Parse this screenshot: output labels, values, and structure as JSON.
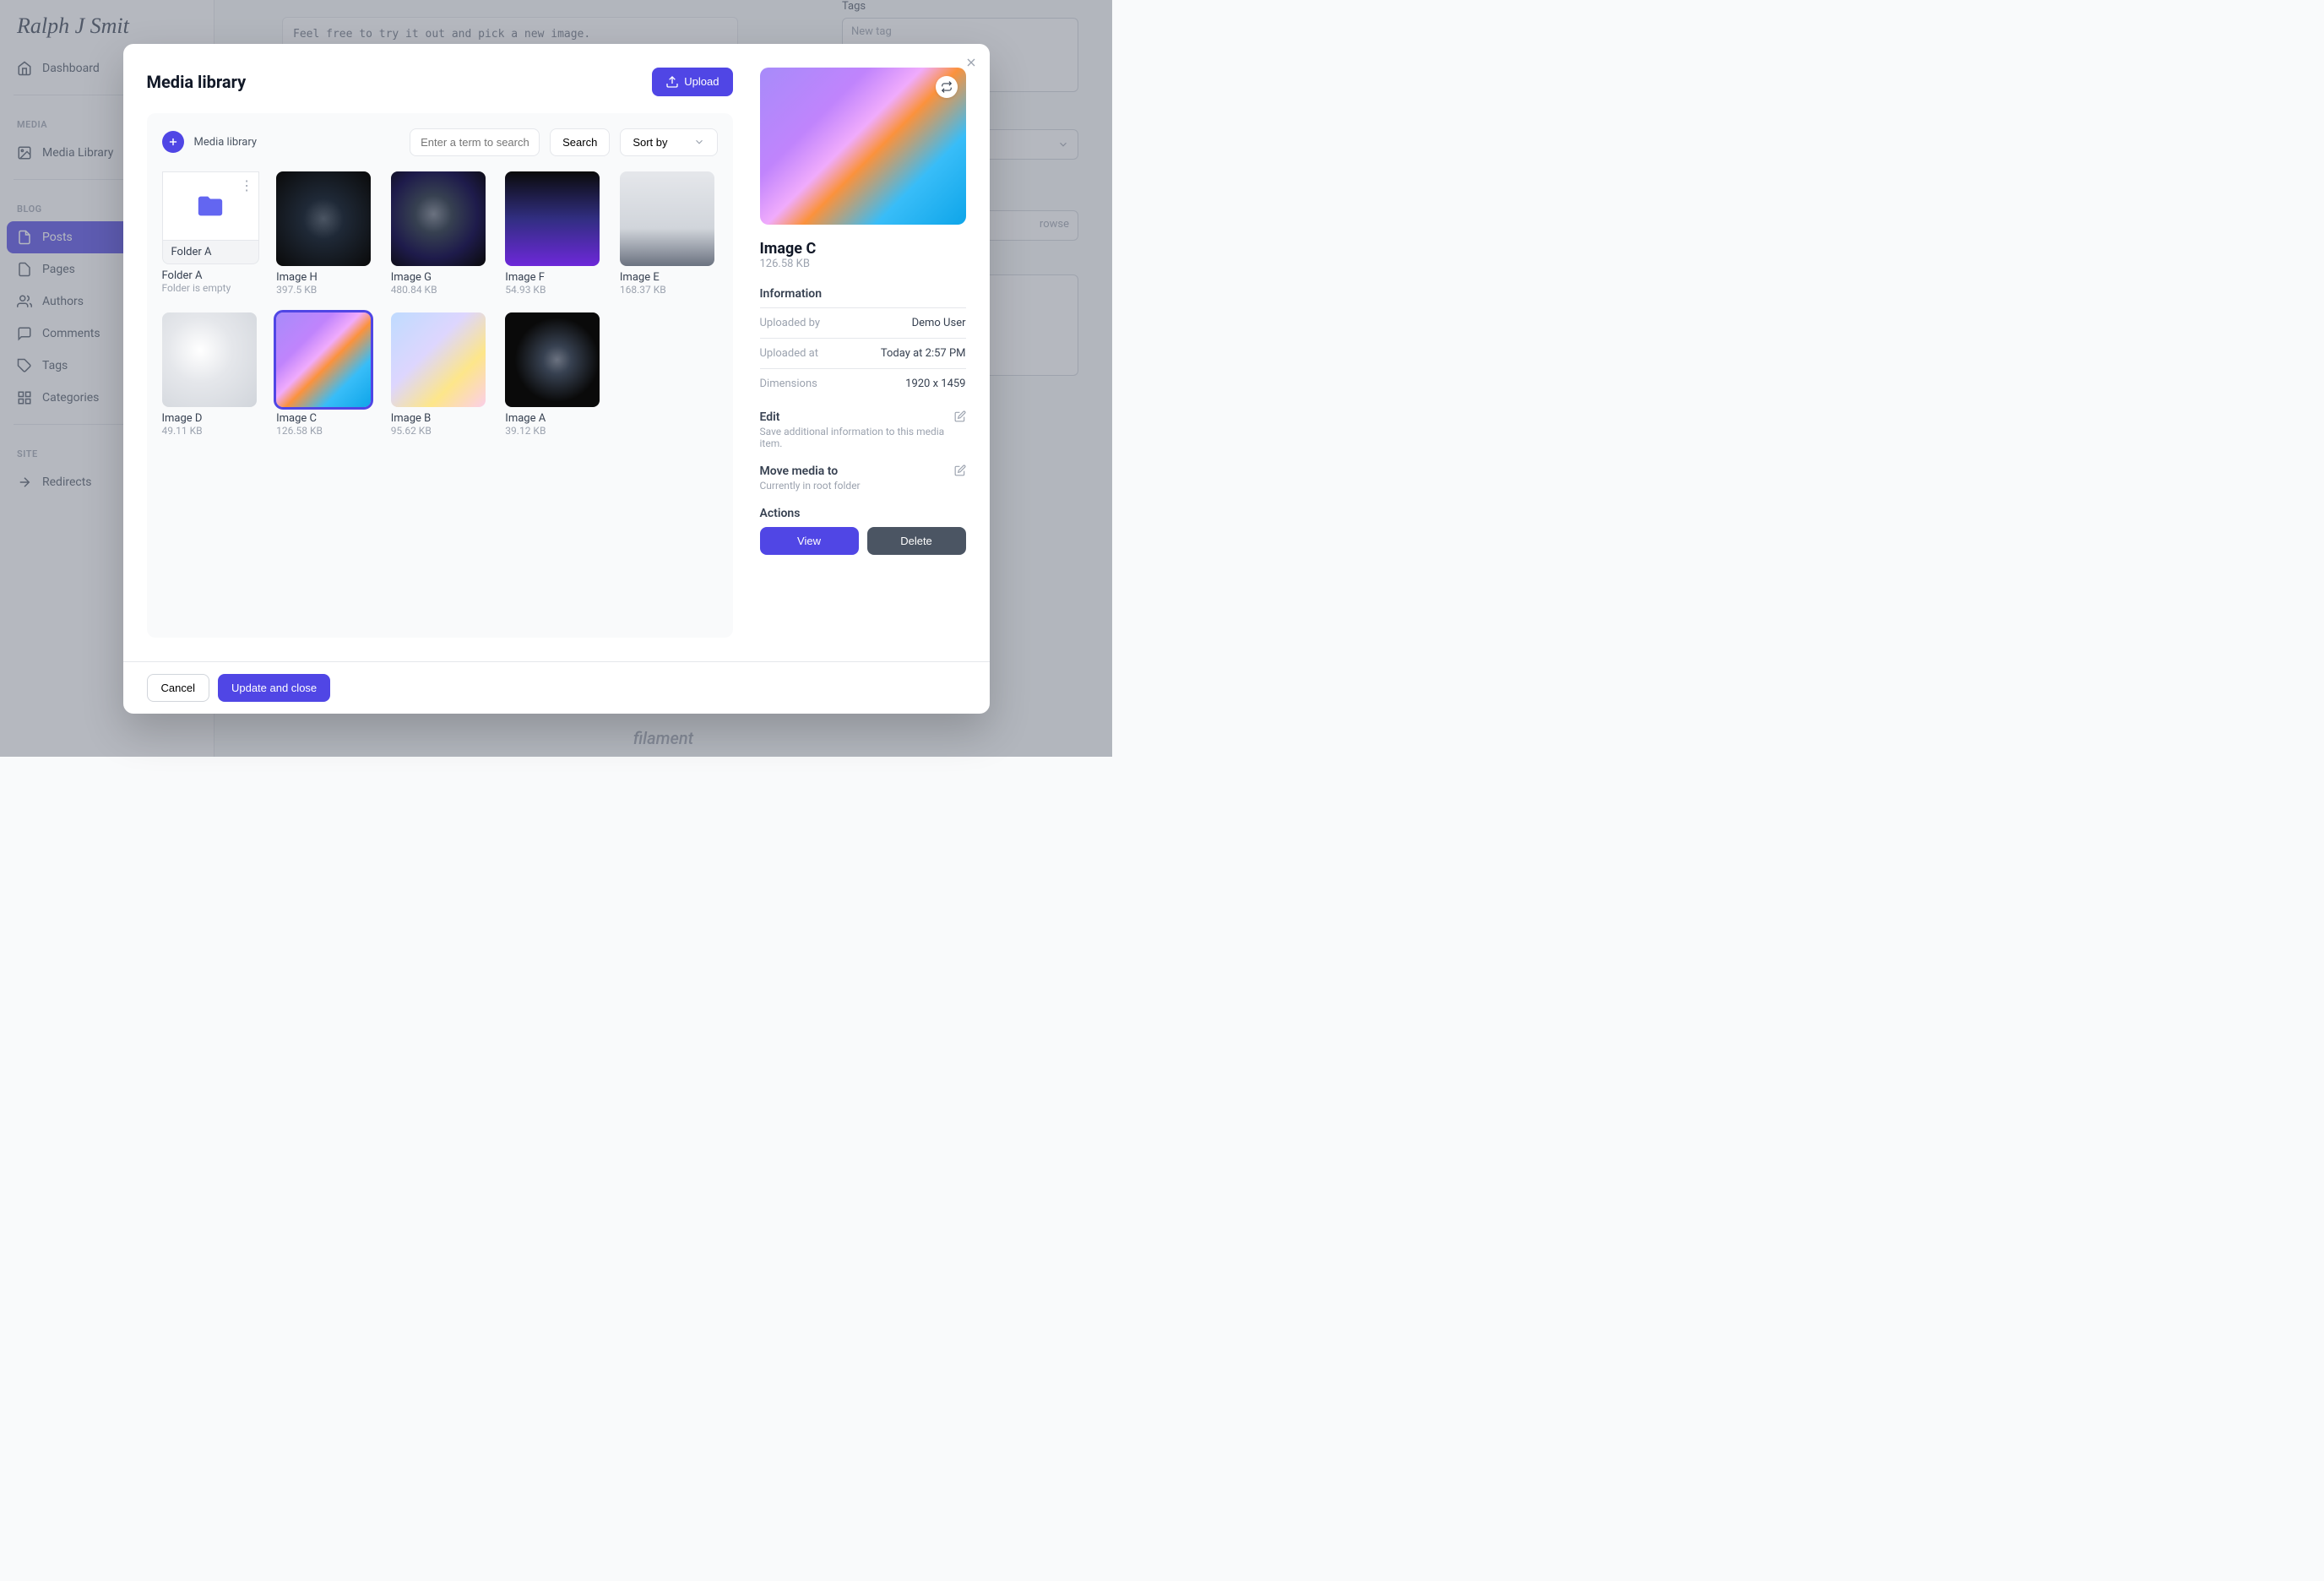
{
  "logo": "Ralph J Smit",
  "nav": {
    "dashboard": "Dashboard",
    "media_section": "MEDIA",
    "media_library": "Media Library",
    "blog_section": "BLOG",
    "posts": "Posts",
    "pages": "Pages",
    "authors": "Authors",
    "comments": "Comments",
    "tags": "Tags",
    "categories": "Categories",
    "site_section": "SITE",
    "redirects": "Redirects"
  },
  "bg": {
    "placeholder_text": "Feel free to try it out and pick a new image.",
    "tags_label": "Tags",
    "tags_placeholder": "New tag",
    "browse": "rowse",
    "footer": "filament"
  },
  "modal": {
    "title": "Media library",
    "upload": "Upload",
    "breadcrumb": "Media library",
    "search_placeholder": "Enter a term to search",
    "search_btn": "Search",
    "sort_btn": "Sort by",
    "cancel": "Cancel",
    "update": "Update and close"
  },
  "items": [
    {
      "name": "Folder A",
      "meta": "Folder is empty",
      "folder_label": "Folder A"
    },
    {
      "name": "Image H",
      "meta": "397.5 KB"
    },
    {
      "name": "Image G",
      "meta": "480.84 KB"
    },
    {
      "name": "Image F",
      "meta": "54.93 KB"
    },
    {
      "name": "Image E",
      "meta": "168.37 KB"
    },
    {
      "name": "Image D",
      "meta": "49.11 KB"
    },
    {
      "name": "Image C",
      "meta": "126.58 KB"
    },
    {
      "name": "Image B",
      "meta": "95.62 KB"
    },
    {
      "name": "Image A",
      "meta": "39.12 KB"
    }
  ],
  "details": {
    "title": "Image C",
    "size": "126.58 KB",
    "info_heading": "Information",
    "uploaded_by_label": "Uploaded by",
    "uploaded_by": "Demo User",
    "uploaded_at_label": "Uploaded at",
    "uploaded_at": "Today at 2:57 PM",
    "dimensions_label": "Dimensions",
    "dimensions": "1920 x 1459",
    "edit_title": "Edit",
    "edit_desc": "Save additional information to this media item.",
    "move_title": "Move media to",
    "move_desc": "Currently in root folder",
    "actions_title": "Actions",
    "view": "View",
    "delete": "Delete"
  }
}
